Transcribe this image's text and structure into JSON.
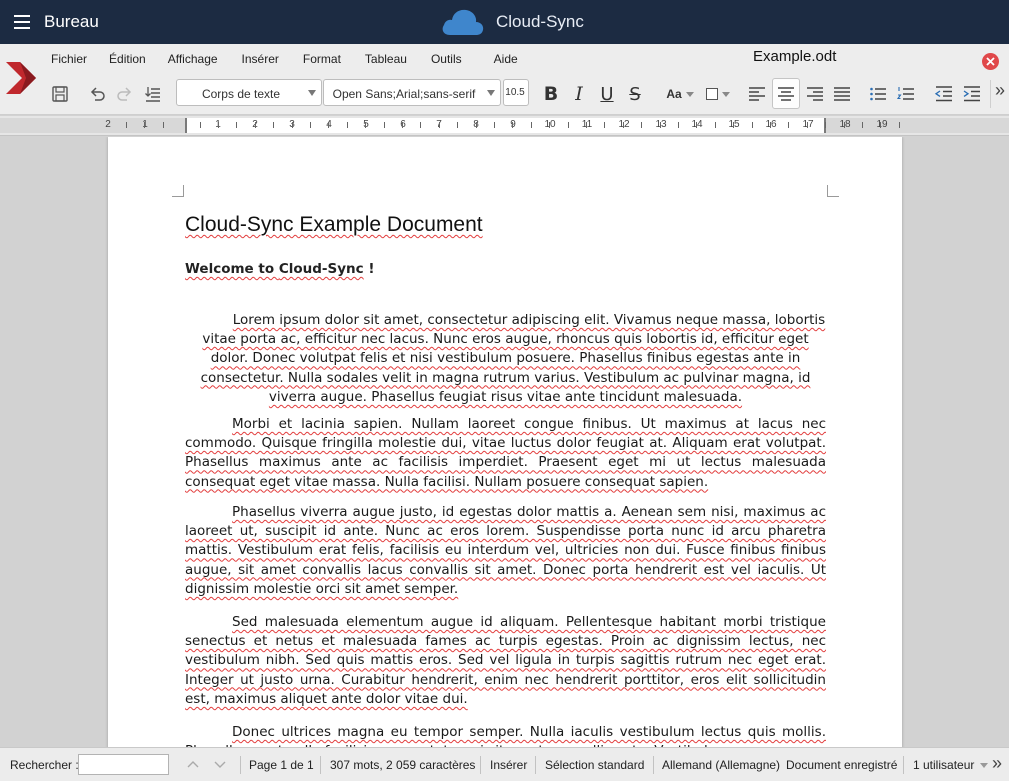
{
  "appbar": {
    "title": "Bureau",
    "brand": "Cloud-Sync",
    "colors": {
      "bar": "#1c2b42",
      "cloud": "#3f86cc"
    }
  },
  "menu": [
    "Fichier",
    "Édition",
    "Affichage",
    "Insérer",
    "Format",
    "Tableau",
    "Outils",
    "Aide"
  ],
  "document_name": "Example.odt",
  "toolbar": {
    "paragraph_style": "Corps de texte",
    "font_name": "Open Sans;Arial;sans-serif",
    "font_size": "10.5",
    "bold": "B",
    "italic": "I",
    "underline": "U",
    "strike": "S",
    "case": "Aa",
    "more": "»",
    "icons": [
      "save-icon",
      "undo-icon",
      "redo-icon",
      "list-icon",
      "align-left-icon",
      "align-center-icon",
      "align-right-icon",
      "justify-icon",
      "bullets-icon",
      "numbering-icon",
      "indent-decrease-icon",
      "indent-increase-icon"
    ]
  },
  "ruler": {
    "labels": [
      "2",
      "1",
      "1",
      "2",
      "3",
      "4",
      "5",
      "6",
      "7",
      "8",
      "9",
      "10",
      "11",
      "12",
      "13",
      "14",
      "15",
      "16",
      "17",
      "18",
      "19"
    ]
  },
  "doc": {
    "title": "Cloud-Sync Example Document",
    "subtitle_a": "Welcome to ",
    "subtitle_b": "Cloud-Sync",
    "subtitle_c": " !",
    "p1": "Lorem ipsum dolor sit amet, consectetur adipiscing elit. Vivamus neque massa, lobortis vitae porta ac, efficitur nec lacus. Nunc eros augue, rhoncus quis lobortis id, efficitur eget dolor. Donec volutpat felis et nisi vestibulum posuere. Phasellus finibus egestas ante in consectetur. Nulla sodales velit in magna rutrum varius. Vestibulum ac pulvinar magna, id viverra augue. Phasellus feugiat risus vitae ante tincidunt malesuada.",
    "p2": "Morbi et lacinia sapien. Nullam laoreet congue finibus. Ut maximus at lacus nec commodo. Quisque fringilla molestie dui, vitae luctus dolor feugiat at. Aliquam erat volutpat. Phasellus maximus ante ac facilisis imperdiet. Praesent eget mi ut lectus malesuada consequat eget vitae massa. Nulla facilisi. Nullam posuere consequat sapien.",
    "p3": "Phasellus viverra augue justo, id egestas dolor mattis a. Aenean sem nisi, maximus ac laoreet ut, suscipit id ante. Nunc ac eros lorem. Suspendisse porta nunc id arcu pharetra mattis. Vestibulum erat felis, facilisis eu interdum vel, ultricies non dui. Fusce finibus finibus augue, sit amet convallis lacus convallis sit amet. Donec porta hendrerit est vel iaculis. Ut dignissim molestie orci sit amet semper.",
    "p4": "Sed malesuada elementum augue id aliquam. Pellentesque habitant morbi tristique senectus et netus et malesuada fames ac turpis egestas. Proin ac dignissim lectus, nec vestibulum nibh. Sed quis mattis eros. Sed vel ligula in turpis sagittis rutrum nec eget erat. Integer ut justo urna. Curabitur hendrerit, enim nec hendrerit porttitor, eros elit sollicitudin est, maximus aliquet ante dolor vitae dui.",
    "p5": "Donec ultrices magna eu tempor semper. Nulla iaculis vestibulum lectus quis mollis. Phasellus eget nulla facilisis, consectetur mi sit amet, convallis ante. Vestibulum"
  },
  "status": {
    "search_label": "Rechercher :",
    "search_value": "",
    "page": "Page 1 de 1",
    "words": "307 mots, 2 059 caractères",
    "insert_mode": "Insérer",
    "selection_mode": "Sélection standard",
    "language": "Allemand (Allemagne)",
    "doc_state": "Document enregistré",
    "users": "1 utilisateur",
    "more": "»"
  }
}
